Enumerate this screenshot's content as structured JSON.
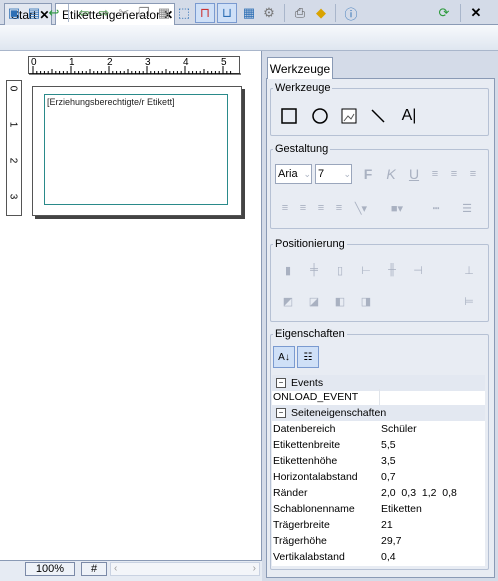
{
  "tabs": [
    {
      "label": "Start"
    },
    {
      "label": "Etikettengenerator"
    }
  ],
  "canvas": {
    "ruler_h_labels": [
      "0",
      "1",
      "2",
      "3",
      "4",
      "5"
    ],
    "ruler_v_labels": [
      "0",
      "1",
      "2",
      "3"
    ],
    "label_placeholder": "[Erziehungsberechtigte/r Etikett]",
    "zoom": "100%",
    "hash": "#"
  },
  "panel": {
    "tab": "Werkzeuge",
    "werkzeuge_title": "Werkzeuge",
    "gestaltung_title": "Gestaltung",
    "font_name": "Aria",
    "font_size": "7",
    "positionierung_title": "Positionierung",
    "eigenschaften_title": "Eigenschaften"
  },
  "properties": {
    "events_category": "Events",
    "onload": "ONLOAD_EVENT",
    "seiten_category": "Seiteneigenschaften",
    "rows": [
      {
        "k": "Datenbereich",
        "v": "Schüler"
      },
      {
        "k": "Etikettenbreite",
        "v": "5,5"
      },
      {
        "k": "Etikettenhöhe",
        "v": "3,5"
      },
      {
        "k": "Horizontalabstand",
        "v": "0,7"
      },
      {
        "k": "Ränder",
        "v": "2,0  0,3  1,2  0,8"
      },
      {
        "k": "Schablonenname",
        "v": "Etiketten"
      },
      {
        "k": "Trägerbreite",
        "v": "21"
      },
      {
        "k": "Trägerhöhe",
        "v": "29,7"
      },
      {
        "k": "Vertikalabstand",
        "v": "0,4"
      }
    ]
  }
}
